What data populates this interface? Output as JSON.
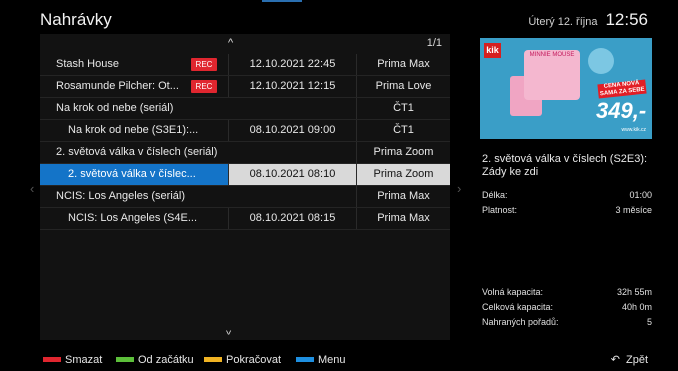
{
  "header": {
    "title": "Nahrávky",
    "date": "Úterý 12. října",
    "time": "12:56"
  },
  "list": {
    "page": "1/1",
    "rows": [
      {
        "name": "Stash House",
        "rec": "REC",
        "datetime": "12.10.2021 22:45",
        "channel": "Prima Max"
      },
      {
        "name": "Rosamunde Pilcher: Ot...",
        "rec": "REC",
        "datetime": "12.10.2021 12:15",
        "channel": "Prima Love"
      },
      {
        "name": "Na krok od nebe (seriál)",
        "channel": "ČT1"
      },
      {
        "name": "Na krok od nebe (S3E1):...",
        "datetime": "08.10.2021 09:00",
        "channel": "ČT1"
      },
      {
        "name": "2. světová válka v číslech (seriál)",
        "channel": "Prima Zoom"
      },
      {
        "name": "2. světová válka v číslec...",
        "datetime": "08.10.2021 08:10",
        "channel": "Prima Zoom"
      },
      {
        "name": "NCIS: Los Angeles (seriál)",
        "channel": "Prima Max"
      },
      {
        "name": "NCIS: Los Angeles (S4E...",
        "datetime": "08.10.2021 08:15",
        "channel": "Prima Max"
      }
    ]
  },
  "poster": {
    "logo": "kik",
    "product": "MINNIE MOUSE",
    "promo": "CENA NOVÁ SAMA ZA SEBE",
    "price": "349,-",
    "url": "www.kik.cz"
  },
  "detail": {
    "title": "2. světová válka v číslech (S2E3): Zády ke zdi",
    "duration_label": "Délka:",
    "duration": "01:00",
    "validity_label": "Platnost:",
    "validity": "3 měsíce",
    "free_label": "Volná kapacita:",
    "free": "32h 55m",
    "total_label": "Celková kapacita:",
    "total": "40h 0m",
    "count_label": "Nahraných pořadů:",
    "count": "5"
  },
  "footer": {
    "delete": "Smazat",
    "restart": "Od začátku",
    "continue": "Pokračovat",
    "menu": "Menu",
    "back": "Zpět",
    "colors": {
      "red": "#e0262f",
      "green": "#5cbf3a",
      "yellow": "#f0b323",
      "blue": "#1e8fe0"
    }
  },
  "icons": {
    "up": "chevron-up-icon",
    "down": "chevron-down-icon",
    "back": "return-arrow-icon"
  }
}
